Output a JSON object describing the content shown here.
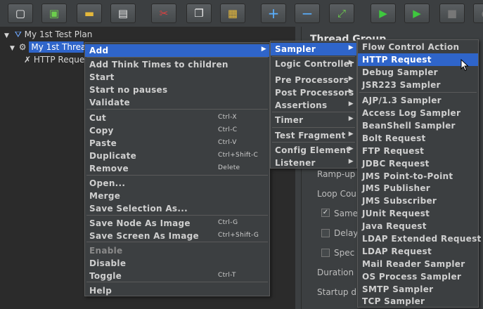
{
  "toolbar": {
    "buttons": [
      {
        "icon": "new-file-icon",
        "glyph": "▢"
      },
      {
        "icon": "templates-icon",
        "glyph": "▣"
      },
      {
        "icon": "open-folder-icon",
        "glyph": "▬"
      },
      {
        "icon": "save-icon",
        "glyph": "▤"
      },
      {
        "icon": "cut-icon",
        "glyph": "✂"
      },
      {
        "icon": "copy-icon",
        "glyph": "❐"
      },
      {
        "icon": "paste-icon",
        "glyph": "▦"
      },
      {
        "icon": "expand-icon",
        "glyph": "+"
      },
      {
        "icon": "collapse-icon",
        "glyph": "−"
      },
      {
        "icon": "toggle-icon",
        "glyph": "⤢"
      },
      {
        "icon": "start-icon",
        "glyph": "▶"
      },
      {
        "icon": "start-no-pauses-icon",
        "glyph": "▶"
      },
      {
        "icon": "stop-icon",
        "glyph": "■"
      },
      {
        "icon": "shutdown-icon",
        "glyph": "●"
      }
    ]
  },
  "tree": {
    "plan": "My 1st Test Plan",
    "thread_group": "My 1st Threa",
    "sampler": "HTTP Reque"
  },
  "right_panel": {
    "title": "Thread Group",
    "rampup": "Ramp-up",
    "loop": "Loop Cou",
    "same": "Same",
    "delay": "Delay",
    "spec": "Spec",
    "duration": "Duration",
    "startup": "Startup d"
  },
  "context_menu": {
    "items": [
      {
        "label": "Add",
        "shortcut": "",
        "submenu": true
      },
      {
        "sep": true
      },
      {
        "label": "Add Think Times to children"
      },
      {
        "label": "Start"
      },
      {
        "label": "Start no pauses"
      },
      {
        "label": "Validate"
      },
      {
        "sep": true
      },
      {
        "label": "Cut",
        "shortcut": "Ctrl-X"
      },
      {
        "label": "Copy",
        "shortcut": "Ctrl-C"
      },
      {
        "label": "Paste",
        "shortcut": "Ctrl-V"
      },
      {
        "label": "Duplicate",
        "shortcut": "Ctrl+Shift-C"
      },
      {
        "label": "Remove",
        "shortcut": "Delete"
      },
      {
        "sep": true
      },
      {
        "label": "Open..."
      },
      {
        "label": "Merge"
      },
      {
        "label": "Save Selection As..."
      },
      {
        "sep": true
      },
      {
        "label": "Save Node As Image",
        "shortcut": "Ctrl-G"
      },
      {
        "label": "Save Screen As Image",
        "shortcut": "Ctrl+Shift-G"
      },
      {
        "sep": true
      },
      {
        "label": "Enable",
        "disabled": true
      },
      {
        "label": "Disable"
      },
      {
        "label": "Toggle",
        "shortcut": "Ctrl-T"
      },
      {
        "sep": true
      },
      {
        "label": "Help"
      }
    ]
  },
  "add_submenu": {
    "items": [
      {
        "label": "Sampler"
      },
      {
        "label": "Logic Controller"
      },
      {
        "label": "Pre Processors"
      },
      {
        "label": "Post Processors"
      },
      {
        "label": "Assertions"
      },
      {
        "label": "Timer"
      },
      {
        "label": "Test Fragment"
      },
      {
        "label": "Config Element"
      },
      {
        "label": "Listener"
      }
    ]
  },
  "sampler_submenu": {
    "items": [
      "Flow Control Action",
      "HTTP Request",
      "Debug Sampler",
      "JSR223 Sampler",
      "AJP/1.3 Sampler",
      "Access Log Sampler",
      "BeanShell Sampler",
      "Bolt Request",
      "FTP Request",
      "JDBC Request",
      "JMS Point-to-Point",
      "JMS Publisher",
      "JMS Subscriber",
      "JUnit Request",
      "Java Request",
      "LDAP Extended Request",
      "LDAP Request",
      "Mail Reader Sampler",
      "OS Process Sampler",
      "SMTP Sampler",
      "TCP Sampler"
    ]
  },
  "colors": {
    "accent": "#2f65ca",
    "panel": "#3c3f41",
    "tree_bg": "#2b2b2b"
  }
}
